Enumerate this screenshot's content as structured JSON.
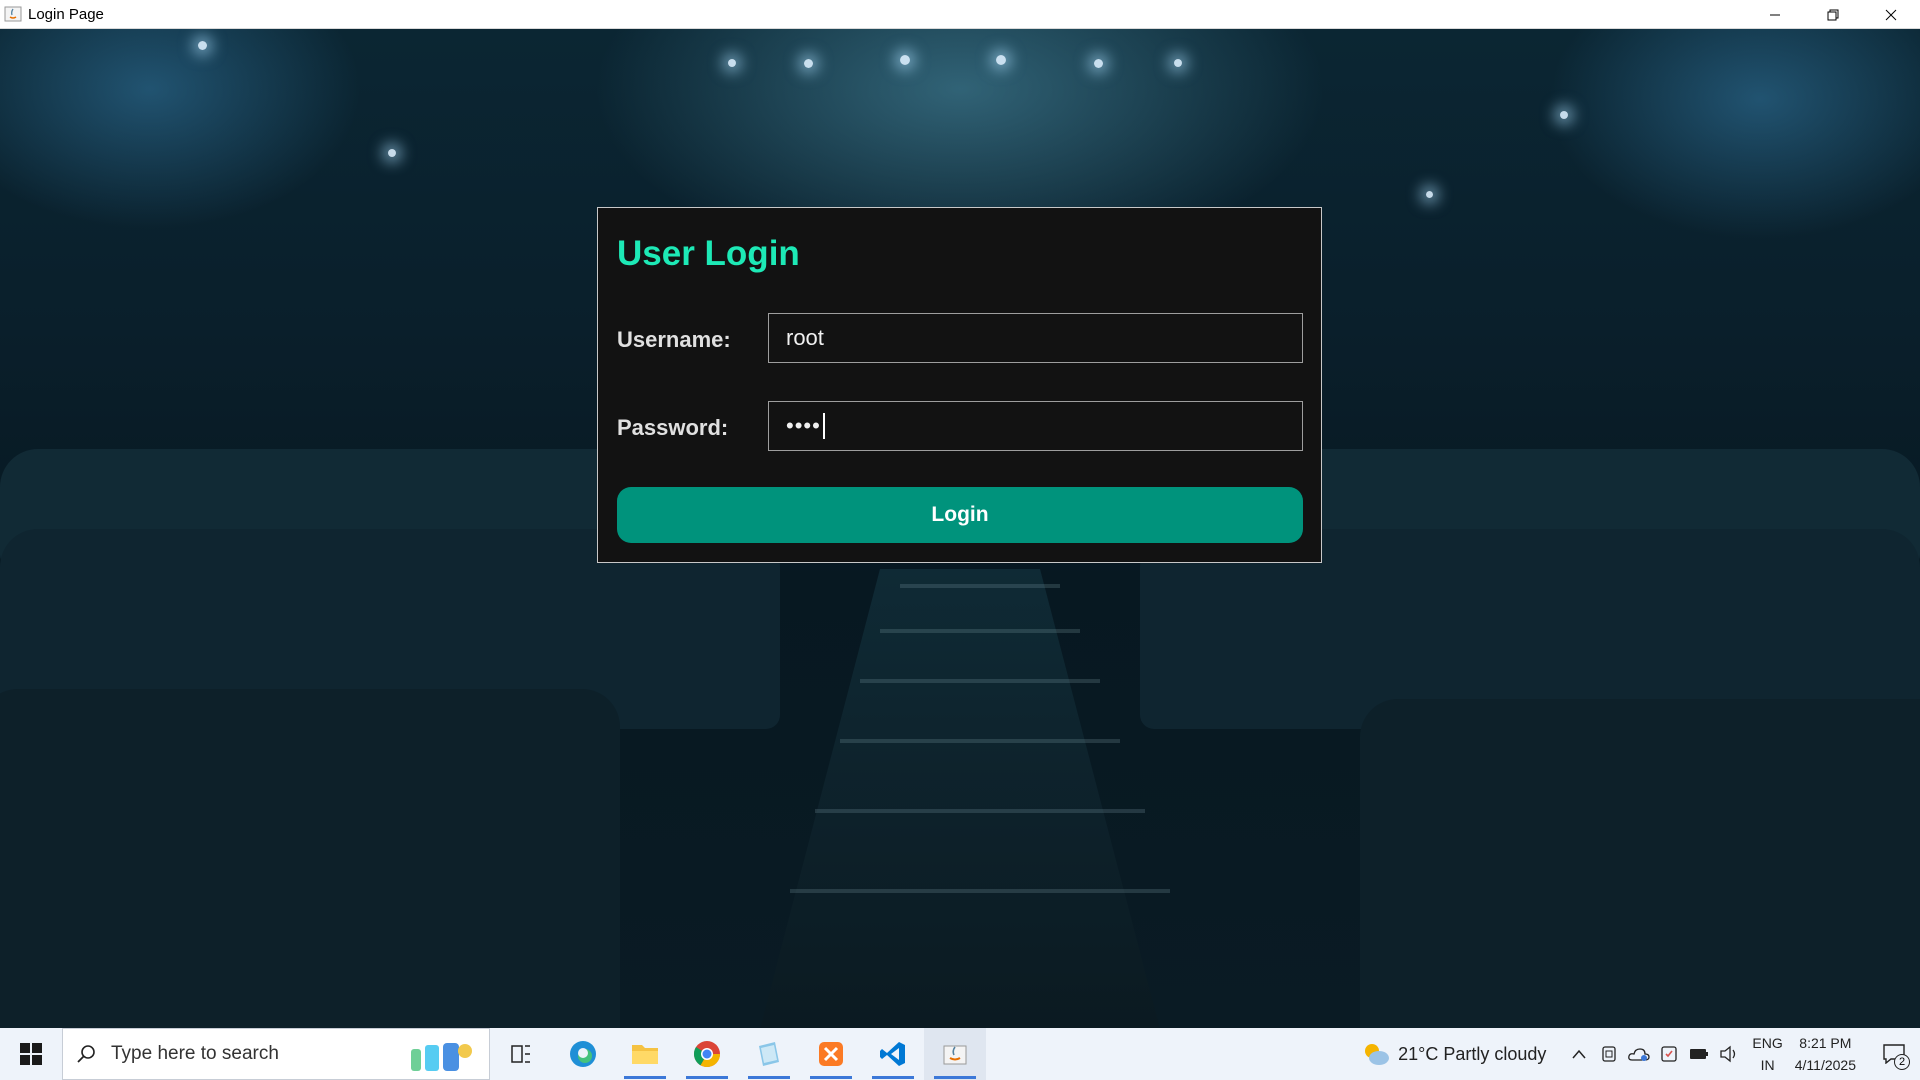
{
  "window": {
    "title": "Login Page"
  },
  "login": {
    "title": "User Login",
    "username_label": "Username:",
    "username_value": "root",
    "password_label": "Password:",
    "password_masked": "••••",
    "button_label": "Login"
  },
  "taskbar": {
    "search_placeholder": "Type here to search",
    "pinned_apps": [
      "task-view-icon",
      "edge-icon",
      "file-explorer-icon",
      "chrome-icon",
      "notepad-icon",
      "xampp-icon",
      "vscode-icon",
      "java-icon"
    ],
    "weather": "21°C  Partly cloudy",
    "language_line1": "ENG",
    "language_line2": "IN",
    "time": "8:21 PM",
    "date": "4/11/2025",
    "notification_count": "2"
  },
  "colors": {
    "accent": "#1de9b6",
    "button": "#00937c",
    "panel": "#121212"
  }
}
